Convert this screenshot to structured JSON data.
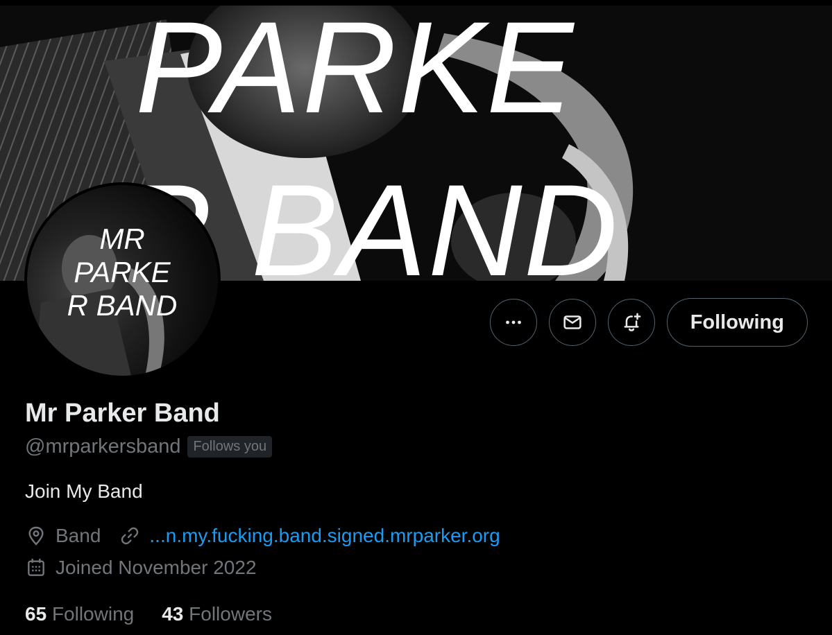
{
  "banner": {
    "line1": "PARKE",
    "line2": "R BAND"
  },
  "avatar": {
    "line1": "MR",
    "line2": "PARKE",
    "line3": "R BAND"
  },
  "actions": {
    "more_icon": "more-horizontal-icon",
    "message_icon": "mail-icon",
    "notify_icon": "bell-plus-icon",
    "follow_label": "Following"
  },
  "profile": {
    "name": "Mr Parker Band",
    "handle": "@mrparkersband",
    "follows_you": "Follows you",
    "bio": "Join My Band",
    "location": "Band",
    "website": "...n.my.fucking.band.signed.mrparker.org",
    "joined": "Joined November 2022"
  },
  "stats": {
    "following_count": "65",
    "following_label": "Following",
    "followers_count": "43",
    "followers_label": "Followers"
  },
  "colors": {
    "background": "#000000",
    "text_primary": "#e7e9ea",
    "text_secondary": "#71767b",
    "link": "#1d9bf0",
    "border": "#536471"
  }
}
